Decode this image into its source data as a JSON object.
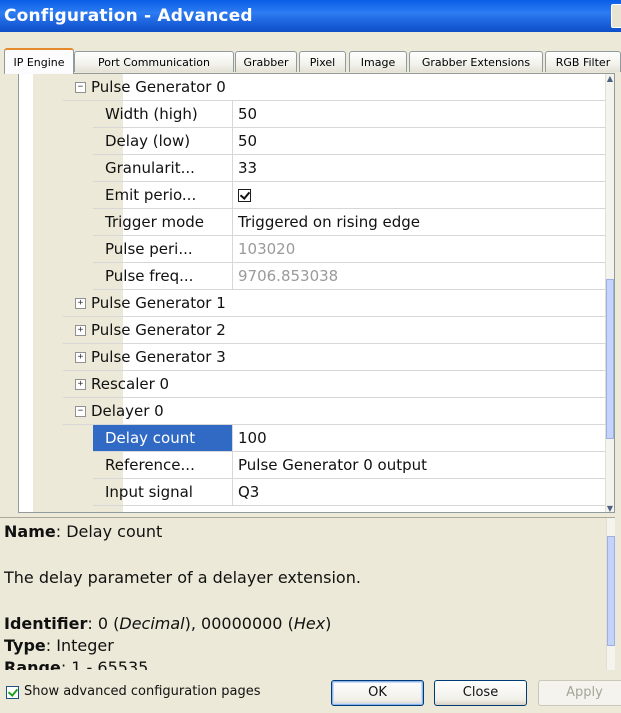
{
  "window": {
    "title": "Configuration - Advanced"
  },
  "tabs": [
    {
      "label": "IP Engine",
      "active": true
    },
    {
      "label": "Port Communication"
    },
    {
      "label": "Grabber"
    },
    {
      "label": "Pixel"
    },
    {
      "label": "Image"
    },
    {
      "label": "Grabber Extensions"
    },
    {
      "label": "RGB Filter"
    }
  ],
  "grid": {
    "group_open": "Pulse Generator 0",
    "props": [
      {
        "name": "Width (high)",
        "value": "50"
      },
      {
        "name": "Delay (low)",
        "value": "50"
      },
      {
        "name": "Granularit...",
        "value": "33"
      },
      {
        "name": "Emit perio...",
        "value": ""
      },
      {
        "name": "Trigger mode",
        "value": "Triggered on rising edge"
      },
      {
        "name": "Pulse peri...",
        "value": "103020"
      },
      {
        "name": "Pulse freq...",
        "value": "9706.853038"
      }
    ],
    "collapsed_groups": [
      "Pulse Generator 1",
      "Pulse Generator 2",
      "Pulse Generator 3",
      "Rescaler 0"
    ],
    "group_open2": "Delayer 0",
    "props2": [
      {
        "name": "Delay count",
        "value": "100"
      },
      {
        "name": "Reference...",
        "value": "Pulse Generator 0 output"
      },
      {
        "name": "Input signal",
        "value": "Q3"
      }
    ],
    "expand_glyph": "⊞",
    "collapse_glyph": "⊟"
  },
  "description": {
    "name_label": "Name",
    "name_value": ": Delay count",
    "text": "The delay parameter of a delayer extension.",
    "identifier_label": "Identifier",
    "identifier_value_1": ": 0 (",
    "identifier_dec": "Decimal",
    "identifier_value_2": "), 00000000 (",
    "identifier_hex": "Hex",
    "identifier_value_3": ")",
    "type_label": "Type",
    "type_value": ": Integer",
    "range_label": "Range",
    "range_value": ": 1 - 65535"
  },
  "footer": {
    "show_advanced_label": "Show advanced configuration pages",
    "ok_label": "OK",
    "close_label": "Close",
    "apply_label": "Apply"
  },
  "colors": {
    "title_bar": "#0a5ee6",
    "selection": "#316ac5",
    "tab_highlight": "#e68b2c"
  }
}
